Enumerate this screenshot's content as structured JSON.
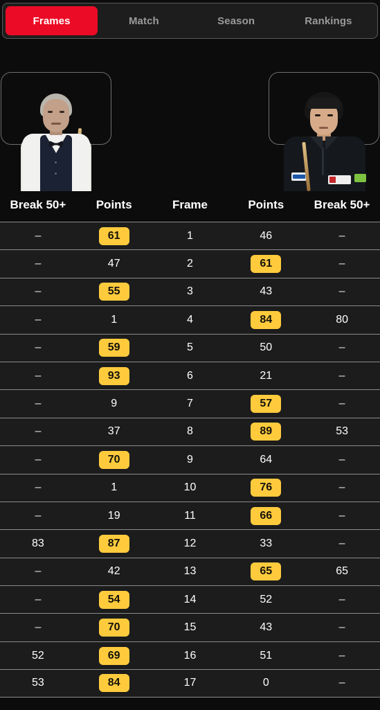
{
  "tabs": [
    {
      "label": "Frames",
      "active": true
    },
    {
      "label": "Match",
      "active": false
    },
    {
      "label": "Season",
      "active": false
    },
    {
      "label": "Rankings",
      "active": false
    }
  ],
  "players": {
    "left": {
      "name": "player-left",
      "description": "older male snooker player, grey hair, white shirt, dark waistcoat, bow tie, holding cue"
    },
    "right": {
      "name": "player-right",
      "description": "young male snooker player, dark hair, black sponsored polo shirt, holding cue"
    }
  },
  "colors": {
    "accent_red": "#ec0b26",
    "badge_gold": "#ffcb3d",
    "page_bg": "#0c0c0c",
    "row_bg": "#1c1c1c",
    "row_divider": "#8b8b8b",
    "tab_inactive_text": "#9a9a9a"
  },
  "table": {
    "headers": [
      "Break 50+",
      "Points",
      "Frame",
      "Points",
      "Break 50+"
    ],
    "rows": [
      {
        "left_break": "–",
        "left_points": "61",
        "left_win": true,
        "frame": "1",
        "right_points": "46",
        "right_win": false,
        "right_break": "–"
      },
      {
        "left_break": "–",
        "left_points": "47",
        "left_win": false,
        "frame": "2",
        "right_points": "61",
        "right_win": true,
        "right_break": "–"
      },
      {
        "left_break": "–",
        "left_points": "55",
        "left_win": true,
        "frame": "3",
        "right_points": "43",
        "right_win": false,
        "right_break": "–"
      },
      {
        "left_break": "–",
        "left_points": "1",
        "left_win": false,
        "frame": "4",
        "right_points": "84",
        "right_win": true,
        "right_break": "80"
      },
      {
        "left_break": "–",
        "left_points": "59",
        "left_win": true,
        "frame": "5",
        "right_points": "50",
        "right_win": false,
        "right_break": "–"
      },
      {
        "left_break": "–",
        "left_points": "93",
        "left_win": true,
        "frame": "6",
        "right_points": "21",
        "right_win": false,
        "right_break": "–"
      },
      {
        "left_break": "–",
        "left_points": "9",
        "left_win": false,
        "frame": "7",
        "right_points": "57",
        "right_win": true,
        "right_break": "–"
      },
      {
        "left_break": "–",
        "left_points": "37",
        "left_win": false,
        "frame": "8",
        "right_points": "89",
        "right_win": true,
        "right_break": "53"
      },
      {
        "left_break": "–",
        "left_points": "70",
        "left_win": true,
        "frame": "9",
        "right_points": "64",
        "right_win": false,
        "right_break": "–"
      },
      {
        "left_break": "–",
        "left_points": "1",
        "left_win": false,
        "frame": "10",
        "right_points": "76",
        "right_win": true,
        "right_break": "–"
      },
      {
        "left_break": "–",
        "left_points": "19",
        "left_win": false,
        "frame": "11",
        "right_points": "66",
        "right_win": true,
        "right_break": "–"
      },
      {
        "left_break": "83",
        "left_points": "87",
        "left_win": true,
        "frame": "12",
        "right_points": "33",
        "right_win": false,
        "right_break": "–"
      },
      {
        "left_break": "–",
        "left_points": "42",
        "left_win": false,
        "frame": "13",
        "right_points": "65",
        "right_win": true,
        "right_break": "65"
      },
      {
        "left_break": "–",
        "left_points": "54",
        "left_win": true,
        "frame": "14",
        "right_points": "52",
        "right_win": false,
        "right_break": "–"
      },
      {
        "left_break": "–",
        "left_points": "70",
        "left_win": true,
        "frame": "15",
        "right_points": "43",
        "right_win": false,
        "right_break": "–"
      },
      {
        "left_break": "52",
        "left_points": "69",
        "left_win": true,
        "frame": "16",
        "right_points": "51",
        "right_win": false,
        "right_break": "–"
      },
      {
        "left_break": "53",
        "left_points": "84",
        "left_win": true,
        "frame": "17",
        "right_points": "0",
        "right_win": false,
        "right_break": "–"
      }
    ]
  }
}
